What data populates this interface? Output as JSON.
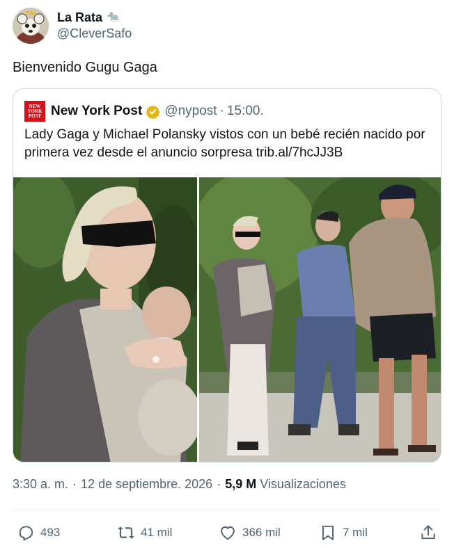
{
  "author": {
    "display_name": "La Rata",
    "emoji": "🐀",
    "handle": "@CleverSafo"
  },
  "tweet": {
    "text": "Bienvenido Gugu Gaga"
  },
  "quote": {
    "logo_text": [
      "NEW",
      "YORK",
      "POST"
    ],
    "display_name": "New York Post",
    "handle": "@nypost",
    "dot": "·",
    "time": "15:00.",
    "text": "Lady Gaga y Michael Polansky vistos con un bebé recién nacido por primera vez desde el anuncio sorpresa trib.al/7hcJJ3B"
  },
  "meta": {
    "time": "3:30 a. m.",
    "sep": "·",
    "date": "12 de septiembre. 2026",
    "views_count": "5,9 M",
    "views_label": "Visualizaciones"
  },
  "actions": {
    "reply_count": "493",
    "retweet_count": "41 mil",
    "like_count": "366 mil",
    "bookmark_count": "7 mil"
  },
  "icons": {
    "reply": "reply-icon",
    "retweet": "retweet-icon",
    "like": "heart-icon",
    "bookmark": "bookmark-icon",
    "share": "share-icon",
    "verified": "verified-badge-icon"
  },
  "colors": {
    "text": "#0f1419",
    "secondary": "#536471",
    "border": "#cfd9de",
    "nyp_red": "#d4101a",
    "verified_gold": "#e2b719"
  }
}
